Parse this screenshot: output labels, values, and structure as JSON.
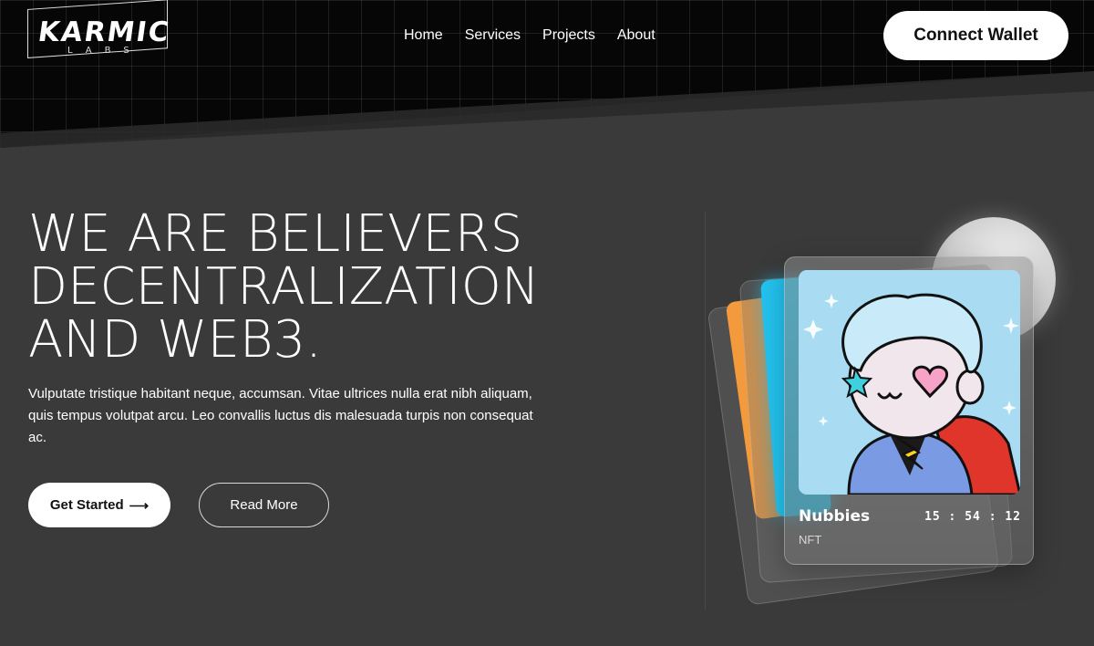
{
  "brand": {
    "logo_main": "KARMIC",
    "logo_sub": "LABS"
  },
  "nav": {
    "items": [
      "Home",
      "Services",
      "Projects",
      "About"
    ]
  },
  "header": {
    "connect_label": "Connect Wallet"
  },
  "hero": {
    "title_lines": [
      "WE ARE BELIEVERS",
      "DECENTRALIZATION",
      "AND WEB3."
    ],
    "description": "Vulputate tristique habitant neque, accumsan. Vitae ultrices nulla erat nibh aliquam, quis tempus volutpat arcu. Leo convallis luctus dis malesuada turpis non consequat ac.",
    "primary_cta": "Get Started",
    "primary_cta_arrow": "⟶",
    "secondary_cta": "Read More"
  },
  "nft_card": {
    "name": "Nubbies",
    "type": "NFT",
    "timer": "15 : 54 : 12"
  },
  "colors": {
    "background": "#3a3a3a",
    "top_band": "#060606",
    "accent_orange": "#f29a3c",
    "accent_cyan": "#23c3f0",
    "art_bg": "#a9dcf3"
  }
}
